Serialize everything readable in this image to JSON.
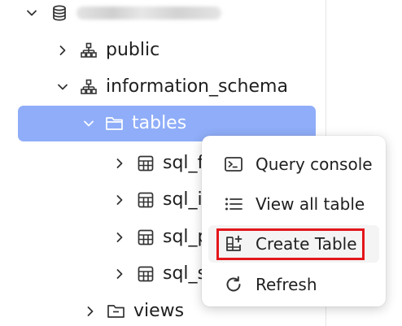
{
  "tree": {
    "database": {
      "icon": "database-icon",
      "expanded": true
    },
    "items": [
      {
        "label": "public",
        "icon": "schema-icon",
        "expanded": false
      },
      {
        "label": "information_schema",
        "icon": "schema-icon",
        "expanded": true
      },
      {
        "label": "tables",
        "icon": "folder-icon",
        "expanded": true,
        "selected": true
      },
      {
        "label": "sql_f",
        "icon": "table-icon",
        "expanded": false
      },
      {
        "label": "sql_i",
        "icon": "table-icon",
        "expanded": false
      },
      {
        "label": "sql_p",
        "icon": "table-icon",
        "expanded": false
      },
      {
        "label": "sql_s",
        "icon": "table-icon",
        "expanded": false
      },
      {
        "label": "views",
        "icon": "folder-icon",
        "expanded": false
      }
    ]
  },
  "context_menu": {
    "items": [
      {
        "label": "Query console",
        "icon": "terminal-icon"
      },
      {
        "label": "View all table",
        "icon": "list-icon"
      },
      {
        "label": "Create Table",
        "icon": "table-add-icon",
        "highlighted": true
      },
      {
        "label": "Refresh",
        "icon": "refresh-icon"
      }
    ]
  },
  "colors": {
    "selection": "#8fadf8",
    "highlight_border": "#e3161b",
    "text": "#1f1f1f",
    "icon": "#333333"
  }
}
